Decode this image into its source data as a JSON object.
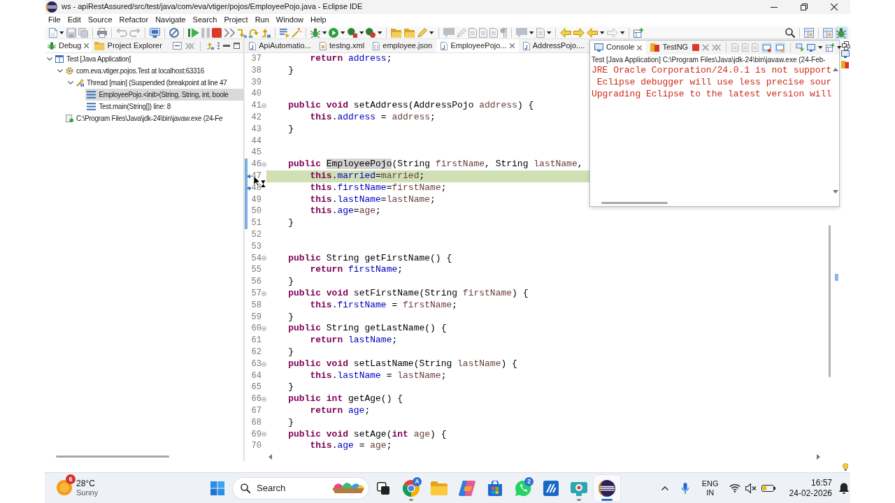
{
  "window": {
    "title": "ws - apiRestAssured/src/test/java/com/eva/vtiger/pojos/EmployeePojo.java - Eclipse IDE"
  },
  "menu": [
    "File",
    "Edit",
    "Source",
    "Refactor",
    "Navigate",
    "Search",
    "Project",
    "Run",
    "Window",
    "Help"
  ],
  "left_panel": {
    "tabs": [
      {
        "label": "Debug",
        "kind": "debug",
        "selected": true
      },
      {
        "label": "Project Explorer",
        "kind": "explorer",
        "selected": false
      }
    ],
    "tree": [
      {
        "label": "Test [Java Application]",
        "kind": "launch",
        "expanded": true,
        "selected": false,
        "children": [
          {
            "label": "com.eva.vtiger.pojos.Test at localhost:63316",
            "kind": "target",
            "expanded": true,
            "selected": false,
            "children": [
              {
                "label": "Thread [main] (Suspended (breakpoint at line 47",
                "kind": "thread",
                "expanded": true,
                "selected": false,
                "children": [
                  {
                    "label": "EmployeePojo.<init>(String, String, int, boole",
                    "kind": "frame",
                    "selected": true
                  },
                  {
                    "label": "Test.main(String[]) line: 8",
                    "kind": "frame",
                    "selected": false
                  }
                ]
              }
            ]
          },
          {
            "label": "C:\\Program Files\\Java\\jdk-24\\bin\\javaw.exe (24-Fe",
            "kind": "process",
            "selected": false
          }
        ]
      }
    ]
  },
  "editor": {
    "tabs": [
      {
        "label": "ApiAutomatio...",
        "kind": "java",
        "selected": false
      },
      {
        "label": "testng.xml",
        "kind": "xml",
        "selected": false
      },
      {
        "label": "employee.json",
        "kind": "json",
        "selected": false
      },
      {
        "label": "EmployeePojo...",
        "kind": "java",
        "selected": true
      },
      {
        "label": "AddressPojo....",
        "kind": "java",
        "selected": false
      }
    ],
    "lines": [
      {
        "number": "37",
        "foldable": false,
        "breakpoint": false,
        "current": false,
        "in_range": false,
        "code": [
          {
            "kind": "keyword",
            "text": "        return"
          },
          {
            "kind": "field",
            "text": " address"
          },
          {
            "kind": "plain",
            "text": ";"
          }
        ]
      },
      {
        "number": "38",
        "foldable": false,
        "breakpoint": false,
        "current": false,
        "in_range": false,
        "code": [
          {
            "kind": "plain",
            "text": "    }"
          }
        ]
      },
      {
        "number": "39",
        "foldable": false,
        "breakpoint": false,
        "current": false,
        "in_range": false
      },
      {
        "number": "40",
        "foldable": false,
        "breakpoint": false,
        "current": false,
        "in_range": false
      },
      {
        "number": "41",
        "foldable": true,
        "breakpoint": false,
        "current": false,
        "in_range": false,
        "code": [
          {
            "kind": "keyword",
            "text": "    public"
          },
          {
            "kind": "keyword",
            "text": " void"
          },
          {
            "kind": "plain",
            "text": " setAddress(AddressPojo"
          },
          {
            "kind": "variable",
            "text": " address"
          },
          {
            "kind": "plain",
            "text": ") {"
          }
        ]
      },
      {
        "number": "42",
        "foldable": false,
        "breakpoint": false,
        "current": false,
        "in_range": false,
        "code": [
          {
            "kind": "keyword",
            "text": "        this"
          },
          {
            "kind": "plain",
            "text": "."
          },
          {
            "kind": "field",
            "text": "address"
          },
          {
            "kind": "plain",
            "text": " = "
          },
          {
            "kind": "variable",
            "text": "address"
          },
          {
            "kind": "plain",
            "text": ";"
          }
        ]
      },
      {
        "number": "43",
        "foldable": false,
        "breakpoint": false,
        "current": false,
        "in_range": false,
        "code": [
          {
            "kind": "plain",
            "text": "    }"
          }
        ]
      },
      {
        "number": "44",
        "foldable": false,
        "breakpoint": false,
        "current": false,
        "in_range": false
      },
      {
        "number": "45",
        "foldable": false,
        "breakpoint": false,
        "current": false,
        "in_range": false
      },
      {
        "number": "46",
        "foldable": true,
        "breakpoint": false,
        "current": false,
        "in_range": true,
        "code": [
          {
            "kind": "keyword",
            "text": "    public "
          },
          {
            "kind": "occurrence",
            "text": "EmployeePojo"
          },
          {
            "kind": "plain",
            "text": "(String"
          },
          {
            "kind": "variable",
            "text": " firstName"
          },
          {
            "kind": "plain",
            "text": ", String"
          },
          {
            "kind": "variable",
            "text": " lastName"
          },
          {
            "kind": "plain",
            "text": ","
          }
        ]
      },
      {
        "number": "47",
        "foldable": false,
        "breakpoint": true,
        "current": true,
        "in_range": true,
        "code": [
          {
            "kind": "keyword",
            "text": "        this"
          },
          {
            "kind": "plain",
            "text": "."
          },
          {
            "kind": "field",
            "text": "married"
          },
          {
            "kind": "plain",
            "text": "="
          },
          {
            "kind": "variable",
            "text": "married"
          },
          {
            "kind": "plain",
            "text": ";"
          }
        ]
      },
      {
        "number": "48",
        "foldable": false,
        "breakpoint": true,
        "current": false,
        "in_range": true,
        "code": [
          {
            "kind": "keyword",
            "text": "        this"
          },
          {
            "kind": "plain",
            "text": "."
          },
          {
            "kind": "field",
            "text": "firstName"
          },
          {
            "kind": "plain",
            "text": "="
          },
          {
            "kind": "variable",
            "text": "firstName"
          },
          {
            "kind": "plain",
            "text": ";"
          }
        ]
      },
      {
        "number": "49",
        "foldable": false,
        "breakpoint": false,
        "current": false,
        "in_range": true,
        "code": [
          {
            "kind": "keyword",
            "text": "        this"
          },
          {
            "kind": "plain",
            "text": "."
          },
          {
            "kind": "field",
            "text": "lastName"
          },
          {
            "kind": "plain",
            "text": "="
          },
          {
            "kind": "variable",
            "text": "lastName"
          },
          {
            "kind": "plain",
            "text": ";"
          }
        ]
      },
      {
        "number": "50",
        "foldable": false,
        "breakpoint": false,
        "current": false,
        "in_range": true,
        "code": [
          {
            "kind": "keyword",
            "text": "        this"
          },
          {
            "kind": "plain",
            "text": "."
          },
          {
            "kind": "field",
            "text": "age"
          },
          {
            "kind": "plain",
            "text": "="
          },
          {
            "kind": "variable",
            "text": "age"
          },
          {
            "kind": "plain",
            "text": ";"
          }
        ]
      },
      {
        "number": "51",
        "foldable": false,
        "breakpoint": false,
        "current": false,
        "in_range": true,
        "code": [
          {
            "kind": "plain",
            "text": "    }"
          }
        ]
      },
      {
        "number": "52",
        "foldable": false,
        "breakpoint": false,
        "current": false,
        "in_range": false
      },
      {
        "number": "53",
        "foldable": false,
        "breakpoint": false,
        "current": false,
        "in_range": false
      },
      {
        "number": "54",
        "foldable": true,
        "breakpoint": false,
        "current": false,
        "in_range": false,
        "code": [
          {
            "kind": "keyword",
            "text": "    public"
          },
          {
            "kind": "plain",
            "text": " String getFirstName() {"
          }
        ]
      },
      {
        "number": "55",
        "foldable": false,
        "breakpoint": false,
        "current": false,
        "in_range": false,
        "code": [
          {
            "kind": "keyword",
            "text": "        return"
          },
          {
            "kind": "field",
            "text": " firstName"
          },
          {
            "kind": "plain",
            "text": ";"
          }
        ]
      },
      {
        "number": "56",
        "foldable": false,
        "breakpoint": false,
        "current": false,
        "in_range": false,
        "code": [
          {
            "kind": "plain",
            "text": "    }"
          }
        ]
      },
      {
        "number": "57",
        "foldable": true,
        "breakpoint": false,
        "current": false,
        "in_range": false,
        "code": [
          {
            "kind": "keyword",
            "text": "    public"
          },
          {
            "kind": "keyword",
            "text": " void"
          },
          {
            "kind": "plain",
            "text": " setFirstName(String"
          },
          {
            "kind": "variable",
            "text": " firstName"
          },
          {
            "kind": "plain",
            "text": ") {"
          }
        ]
      },
      {
        "number": "58",
        "foldable": false,
        "breakpoint": false,
        "current": false,
        "in_range": false,
        "code": [
          {
            "kind": "keyword",
            "text": "        this"
          },
          {
            "kind": "plain",
            "text": "."
          },
          {
            "kind": "field",
            "text": "firstName"
          },
          {
            "kind": "plain",
            "text": " = "
          },
          {
            "kind": "variable",
            "text": "firstName"
          },
          {
            "kind": "plain",
            "text": ";"
          }
        ]
      },
      {
        "number": "59",
        "foldable": false,
        "breakpoint": false,
        "current": false,
        "in_range": false,
        "code": [
          {
            "kind": "plain",
            "text": "    }"
          }
        ]
      },
      {
        "number": "60",
        "foldable": true,
        "breakpoint": false,
        "current": false,
        "in_range": false,
        "code": [
          {
            "kind": "keyword",
            "text": "    public"
          },
          {
            "kind": "plain",
            "text": " String getLastName() {"
          }
        ]
      },
      {
        "number": "61",
        "foldable": false,
        "breakpoint": false,
        "current": false,
        "in_range": false,
        "code": [
          {
            "kind": "keyword",
            "text": "        return"
          },
          {
            "kind": "field",
            "text": " lastName"
          },
          {
            "kind": "plain",
            "text": ";"
          }
        ]
      },
      {
        "number": "62",
        "foldable": false,
        "breakpoint": false,
        "current": false,
        "in_range": false,
        "code": [
          {
            "kind": "plain",
            "text": "    }"
          }
        ]
      },
      {
        "number": "63",
        "foldable": true,
        "breakpoint": false,
        "current": false,
        "in_range": false,
        "code": [
          {
            "kind": "keyword",
            "text": "    public"
          },
          {
            "kind": "keyword",
            "text": " void"
          },
          {
            "kind": "plain",
            "text": " setLastName(String"
          },
          {
            "kind": "variable",
            "text": " lastName"
          },
          {
            "kind": "plain",
            "text": ") {"
          }
        ]
      },
      {
        "number": "64",
        "foldable": false,
        "breakpoint": false,
        "current": false,
        "in_range": false,
        "code": [
          {
            "kind": "keyword",
            "text": "        this"
          },
          {
            "kind": "plain",
            "text": "."
          },
          {
            "kind": "field",
            "text": "lastName"
          },
          {
            "kind": "plain",
            "text": " = "
          },
          {
            "kind": "variable",
            "text": "lastName"
          },
          {
            "kind": "plain",
            "text": ";"
          }
        ]
      },
      {
        "number": "65",
        "foldable": false,
        "breakpoint": false,
        "current": false,
        "in_range": false,
        "code": [
          {
            "kind": "plain",
            "text": "    }"
          }
        ]
      },
      {
        "number": "66",
        "foldable": true,
        "breakpoint": false,
        "current": false,
        "in_range": false,
        "code": [
          {
            "kind": "keyword",
            "text": "    public"
          },
          {
            "kind": "keyword",
            "text": " int"
          },
          {
            "kind": "plain",
            "text": " getAge() {"
          }
        ]
      },
      {
        "number": "67",
        "foldable": false,
        "breakpoint": false,
        "current": false,
        "in_range": false,
        "code": [
          {
            "kind": "keyword",
            "text": "        return"
          },
          {
            "kind": "field",
            "text": " age"
          },
          {
            "kind": "plain",
            "text": ";"
          }
        ]
      },
      {
        "number": "68",
        "foldable": false,
        "breakpoint": false,
        "current": false,
        "in_range": false,
        "code": [
          {
            "kind": "plain",
            "text": "    }"
          }
        ]
      },
      {
        "number": "69",
        "foldable": true,
        "breakpoint": false,
        "current": false,
        "in_range": false,
        "code": [
          {
            "kind": "keyword",
            "text": "    public"
          },
          {
            "kind": "keyword",
            "text": " void"
          },
          {
            "kind": "plain",
            "text": " setAge("
          },
          {
            "kind": "keyword",
            "text": "int"
          },
          {
            "kind": "variable",
            "text": " age"
          },
          {
            "kind": "plain",
            "text": ") {"
          }
        ]
      },
      {
        "number": "70",
        "foldable": false,
        "breakpoint": false,
        "current": false,
        "in_range": false,
        "code": [
          {
            "kind": "keyword",
            "text": "        this"
          },
          {
            "kind": "plain",
            "text": "."
          },
          {
            "kind": "field",
            "text": "age"
          },
          {
            "kind": "plain",
            "text": " = "
          },
          {
            "kind": "variable",
            "text": "age"
          },
          {
            "kind": "plain",
            "text": ";"
          }
        ]
      }
    ]
  },
  "console": {
    "tabs": [
      {
        "label": "Console",
        "kind": "console",
        "selected": true
      },
      {
        "label": "TestNG",
        "kind": "testng",
        "selected": false
      }
    ],
    "process": "Test [Java Application] C:\\Program Files\\Java\\jdk-24\\bin\\javaw.exe (24-Feb-",
    "lines": [
      "JRE Oracle Corporation/24.0.1 is not support",
      " Eclipse debugger will use less precise sour",
      "Upgrading Eclipse to the latest version will"
    ]
  },
  "taskbar": {
    "weather": {
      "badge": "6",
      "temperature": "28°C",
      "condition": "Sunny"
    },
    "search": {
      "placeholder": "Search"
    },
    "apps": [
      {
        "kind": "task_view",
        "running": false,
        "active": false
      },
      {
        "kind": "browser",
        "badge": "A",
        "running": true,
        "active": false
      },
      {
        "kind": "folder",
        "running": false,
        "active": false
      },
      {
        "kind": "assistant",
        "running": false,
        "active": false
      },
      {
        "kind": "store",
        "running": false,
        "active": false
      },
      {
        "kind": "chat",
        "badge": "2",
        "running": false,
        "active": false
      },
      {
        "kind": "editor",
        "running": false,
        "active": false
      },
      {
        "kind": "camera",
        "running": true,
        "active": false
      },
      {
        "kind": "ide",
        "running": true,
        "active": true
      }
    ],
    "tray": {
      "language": "ENG",
      "region": "IN",
      "time": "16:57",
      "date": "24-02-2026"
    }
  }
}
